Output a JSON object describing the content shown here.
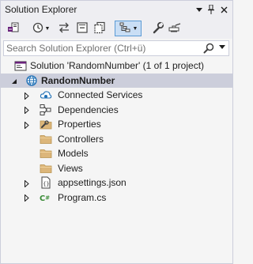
{
  "panel": {
    "title": "Solution Explorer"
  },
  "title_buttons": {
    "dropdown_icon": "chevron-down-icon",
    "pin_icon": "pin-icon",
    "close_icon": "close-icon"
  },
  "toolbar": {
    "items": [
      {
        "icon": "switch-views-icon"
      },
      {
        "icon": "history-icon",
        "has_dropdown": true
      },
      {
        "icon": "sync-icon"
      },
      {
        "icon": "collapse-all-icon"
      },
      {
        "icon": "show-all-files-icon"
      },
      {
        "icon": "solution-filter-icon",
        "has_dropdown": true,
        "selected": true
      },
      {
        "icon": "properties-wrench-icon"
      },
      {
        "icon": "preview-icon"
      }
    ]
  },
  "search": {
    "placeholder": "Search Solution Explorer (Ctrl+ü)",
    "value": ""
  },
  "tree": {
    "solution": {
      "label": "Solution 'RandomNumber' (1 of 1 project)"
    },
    "project": {
      "label": "RandomNumber",
      "expanded": true,
      "selected": true
    },
    "items": [
      {
        "label": "Connected Services",
        "icon": "connected-services-icon",
        "expandable": true
      },
      {
        "label": "Dependencies",
        "icon": "dependencies-icon",
        "expandable": true
      },
      {
        "label": "Properties",
        "icon": "properties-folder-icon",
        "expandable": true
      },
      {
        "label": "Controllers",
        "icon": "folder-icon",
        "expandable": false
      },
      {
        "label": "Models",
        "icon": "folder-icon",
        "expandable": false
      },
      {
        "label": "Views",
        "icon": "folder-icon",
        "expandable": false
      },
      {
        "label": "appsettings.json",
        "icon": "json-file-icon",
        "expandable": true
      },
      {
        "label": "Program.cs",
        "icon": "csharp-file-icon",
        "expandable": true
      }
    ]
  },
  "colors": {
    "accent": "#007acc",
    "selection": "#cccedb",
    "folder": "#dcb67a"
  }
}
